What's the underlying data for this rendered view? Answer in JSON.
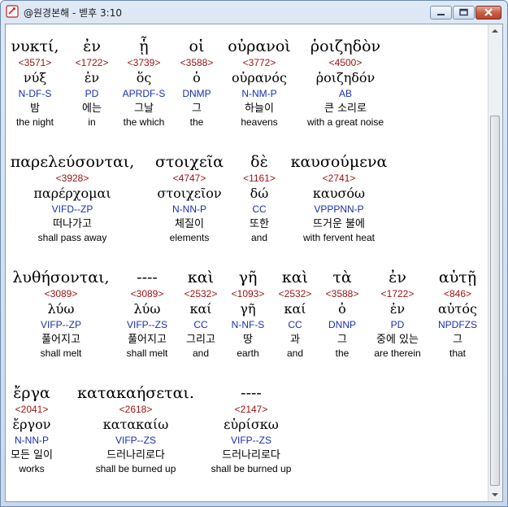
{
  "window": {
    "title": "@원경본해 - 벧후 3:10"
  },
  "lines": [
    {
      "words": [
        {
          "greek": "νυκτί,",
          "strong": "<3571>",
          "lemma": "νύξ",
          "parse": "N-DF-S",
          "korean": "밤",
          "english": "the night"
        },
        {
          "greek": "ἐν",
          "strong": "<1722>",
          "lemma": "ἐν",
          "parse": "PD",
          "korean": "에는",
          "english": "in"
        },
        {
          "greek": "ᾗ",
          "strong": "<3739>",
          "lemma": "ὅς",
          "parse": "APRDF-S",
          "korean": "그날",
          "english": "the which"
        },
        {
          "greek": "οἱ",
          "strong": "<3588>",
          "lemma": "ὁ",
          "parse": "DNMP",
          "korean": "그",
          "english": "the"
        },
        {
          "greek": "οὐρανοὶ",
          "strong": "<3772>",
          "lemma": "οὐρανός",
          "parse": "N-NM-P",
          "korean": "하늘이",
          "english": "heavens"
        },
        {
          "greek": "ῥοιζηδὸν",
          "strong": "<4500>",
          "lemma": "ῥοιζηδόν",
          "parse": "AB",
          "korean": "큰 소리로",
          "english": "with a great noise"
        }
      ]
    },
    {
      "words": [
        {
          "greek": "παρελεύσονται,",
          "strong": "<3928>",
          "lemma": "παρέρχομαι",
          "parse": "VIFD--ZP",
          "korean": "떠나가고",
          "english": "shall pass away"
        },
        {
          "greek": "στοιχεῖα",
          "strong": "<4747>",
          "lemma": "στοιχεῖον",
          "parse": "N-NN-P",
          "korean": "체질이",
          "english": "elements"
        },
        {
          "greek": "δὲ",
          "strong": "<1161>",
          "lemma": "δώ",
          "parse": "CC",
          "korean": "또한",
          "english": "and"
        },
        {
          "greek": "καυσούμενα",
          "strong": "<2741>",
          "lemma": "καυσόω",
          "parse": "VPPPNN-P",
          "korean": "뜨거운 불에",
          "english": "with fervent heat"
        }
      ]
    },
    {
      "words": [
        {
          "greek": "λυθήσονται,",
          "strong": "<3089>",
          "lemma": "λύω",
          "parse": "VIFP--ZP",
          "korean": "풀어지고",
          "english": "shall melt"
        },
        {
          "greek": "----",
          "strong": "<3089>",
          "lemma": "λύω",
          "parse": "VIFP--ZS",
          "korean": "풀어지고",
          "english": "shall melt"
        },
        {
          "greek": "καὶ",
          "strong": "<2532>",
          "lemma": "καί",
          "parse": "CC",
          "korean": "그리고",
          "english": "and"
        },
        {
          "greek": "γῆ",
          "strong": "<1093>",
          "lemma": "γῆ",
          "parse": "N-NF-S",
          "korean": "땅",
          "english": "earth"
        },
        {
          "greek": "καὶ",
          "strong": "<2532>",
          "lemma": "καί",
          "parse": "CC",
          "korean": "과",
          "english": "and"
        },
        {
          "greek": "τὰ",
          "strong": "<3588>",
          "lemma": "ὁ",
          "parse": "DNNP",
          "korean": "그",
          "english": "the"
        },
        {
          "greek": "ἐν",
          "strong": "<1722>",
          "lemma": "ἐν",
          "parse": "PD",
          "korean": "중에 있는",
          "english": "are therein"
        },
        {
          "greek": "αὐτῇ",
          "strong": "<846>",
          "lemma": "αὐτός",
          "parse": "NPDFZS",
          "korean": "그",
          "english": "that"
        }
      ]
    },
    {
      "words": [
        {
          "greek": "ἔργα",
          "strong": "<2041>",
          "lemma": "ἔργον",
          "parse": "N-NN-P",
          "korean": "모든 일이",
          "english": "works"
        },
        {
          "greek": "κατακαήσεται.",
          "strong": "<2618>",
          "lemma": "κατακαίω",
          "parse": "VIFP--ZS",
          "korean": "드러나리로다",
          "english": "shall be burned up"
        },
        {
          "greek": "----",
          "strong": "<2147>",
          "lemma": "εὑρίσκω",
          "parse": "VIFP--ZS",
          "korean": "드러나리로다",
          "english": "shall be burned up"
        }
      ]
    }
  ]
}
